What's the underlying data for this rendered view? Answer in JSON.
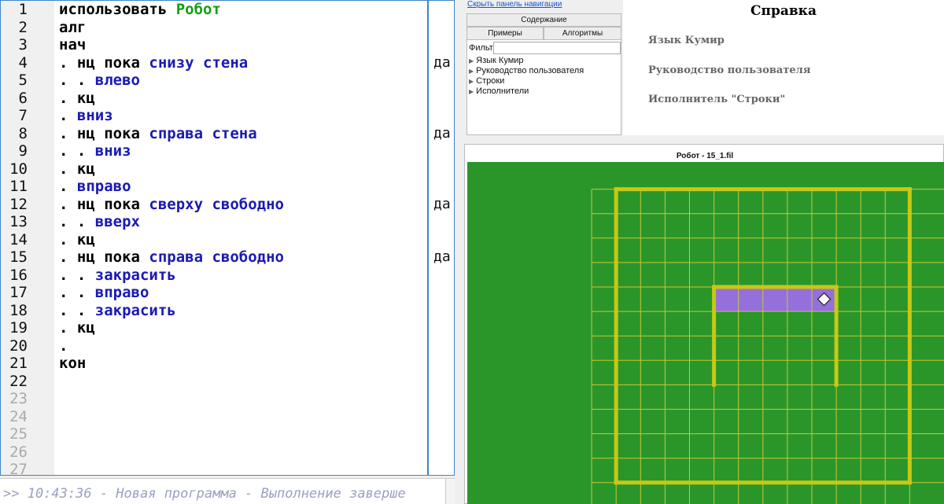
{
  "editor": {
    "lines": [
      {
        "n": "1",
        "tokens": [
          {
            "t": "использовать ",
            "c": "kw"
          },
          {
            "t": "Робот",
            "c": "mod"
          }
        ]
      },
      {
        "n": "2",
        "tokens": [
          {
            "t": "алг",
            "c": "kw"
          }
        ]
      },
      {
        "n": "3",
        "tokens": [
          {
            "t": "нач",
            "c": "kw"
          }
        ]
      },
      {
        "n": "4",
        "tokens": [
          {
            "t": ". нц пока ",
            "c": "kw"
          },
          {
            "t": "снизу стена",
            "c": "fn"
          }
        ],
        "margin": "да"
      },
      {
        "n": "5",
        "tokens": [
          {
            "t": ". . ",
            "c": "kw"
          },
          {
            "t": "влево",
            "c": "fn"
          }
        ]
      },
      {
        "n": "6",
        "tokens": [
          {
            "t": ". кц",
            "c": "kw"
          }
        ]
      },
      {
        "n": "7",
        "tokens": [
          {
            "t": ". ",
            "c": "kw"
          },
          {
            "t": "вниз",
            "c": "fn"
          }
        ]
      },
      {
        "n": "8",
        "tokens": [
          {
            "t": ". нц пока ",
            "c": "kw"
          },
          {
            "t": "справа стена",
            "c": "fn"
          }
        ],
        "margin": "да"
      },
      {
        "n": "9",
        "tokens": [
          {
            "t": ". . ",
            "c": "kw"
          },
          {
            "t": "вниз",
            "c": "fn"
          }
        ]
      },
      {
        "n": "10",
        "tokens": [
          {
            "t": ". кц",
            "c": "kw"
          }
        ]
      },
      {
        "n": "11",
        "tokens": [
          {
            "t": ". ",
            "c": "kw"
          },
          {
            "t": "вправо",
            "c": "fn"
          }
        ]
      },
      {
        "n": "12",
        "tokens": [
          {
            "t": ". нц пока ",
            "c": "kw"
          },
          {
            "t": "сверху свободно",
            "c": "fn"
          }
        ],
        "margin": "да"
      },
      {
        "n": "13",
        "tokens": [
          {
            "t": ". . ",
            "c": "kw"
          },
          {
            "t": "вверх",
            "c": "fn"
          }
        ]
      },
      {
        "n": "14",
        "tokens": [
          {
            "t": ". кц",
            "c": "kw"
          }
        ]
      },
      {
        "n": "15",
        "tokens": [
          {
            "t": ". нц пока ",
            "c": "kw"
          },
          {
            "t": "справа свободно",
            "c": "fn"
          }
        ],
        "margin": "да"
      },
      {
        "n": "16",
        "tokens": [
          {
            "t": ". . ",
            "c": "kw"
          },
          {
            "t": "закрасить",
            "c": "fn"
          }
        ]
      },
      {
        "n": "17",
        "tokens": [
          {
            "t": ". . ",
            "c": "kw"
          },
          {
            "t": "вправо",
            "c": "fn"
          }
        ]
      },
      {
        "n": "18",
        "tokens": [
          {
            "t": ". . ",
            "c": "kw"
          },
          {
            "t": "закрасить",
            "c": "fn"
          }
        ]
      },
      {
        "n": "19",
        "tokens": [
          {
            "t": ". кц",
            "c": "kw"
          }
        ]
      },
      {
        "n": "20",
        "tokens": [
          {
            "t": ".",
            "c": "kw"
          }
        ]
      },
      {
        "n": "21",
        "tokens": [
          {
            "t": "кон",
            "c": "kw"
          }
        ]
      },
      {
        "n": "22",
        "tokens": []
      },
      {
        "n": "23",
        "tokens": [],
        "dim": true
      },
      {
        "n": "24",
        "tokens": [],
        "dim": true
      },
      {
        "n": "25",
        "tokens": [],
        "dim": true
      },
      {
        "n": "26",
        "tokens": [],
        "dim": true
      },
      {
        "n": "27",
        "tokens": [],
        "dim": true
      }
    ]
  },
  "console": {
    "text": ">> 10:43:36 - Новая программа - Выполнение заверше"
  },
  "help_nav": {
    "hide_link": "Скрыть панель навигации",
    "contents_button": "Содержание",
    "examples_button": "Примеры",
    "algorithms_button": "Алгоритмы",
    "filter_label": "Фильтр:",
    "filter_value": "",
    "tree": [
      "Язык Кумир",
      "Руководство пользователя",
      "Строки",
      "Исполнители"
    ]
  },
  "help_content": {
    "title": "Справка",
    "items": [
      "Язык Кумир",
      "Руководство пользователя",
      "Исполнитель \"Строки\""
    ]
  },
  "robot_window": {
    "title": "Робот - 15_1.fil",
    "colors": {
      "field": "#2a962a",
      "grid": "#c8c832",
      "wall": "#c8c814",
      "painted": "#9370db"
    },
    "painted_cells": [
      [
        9,
        5
      ],
      [
        10,
        5
      ],
      [
        11,
        5
      ],
      [
        12,
        5
      ],
      [
        13,
        5
      ]
    ],
    "robot_cell": [
      13,
      5
    ]
  }
}
